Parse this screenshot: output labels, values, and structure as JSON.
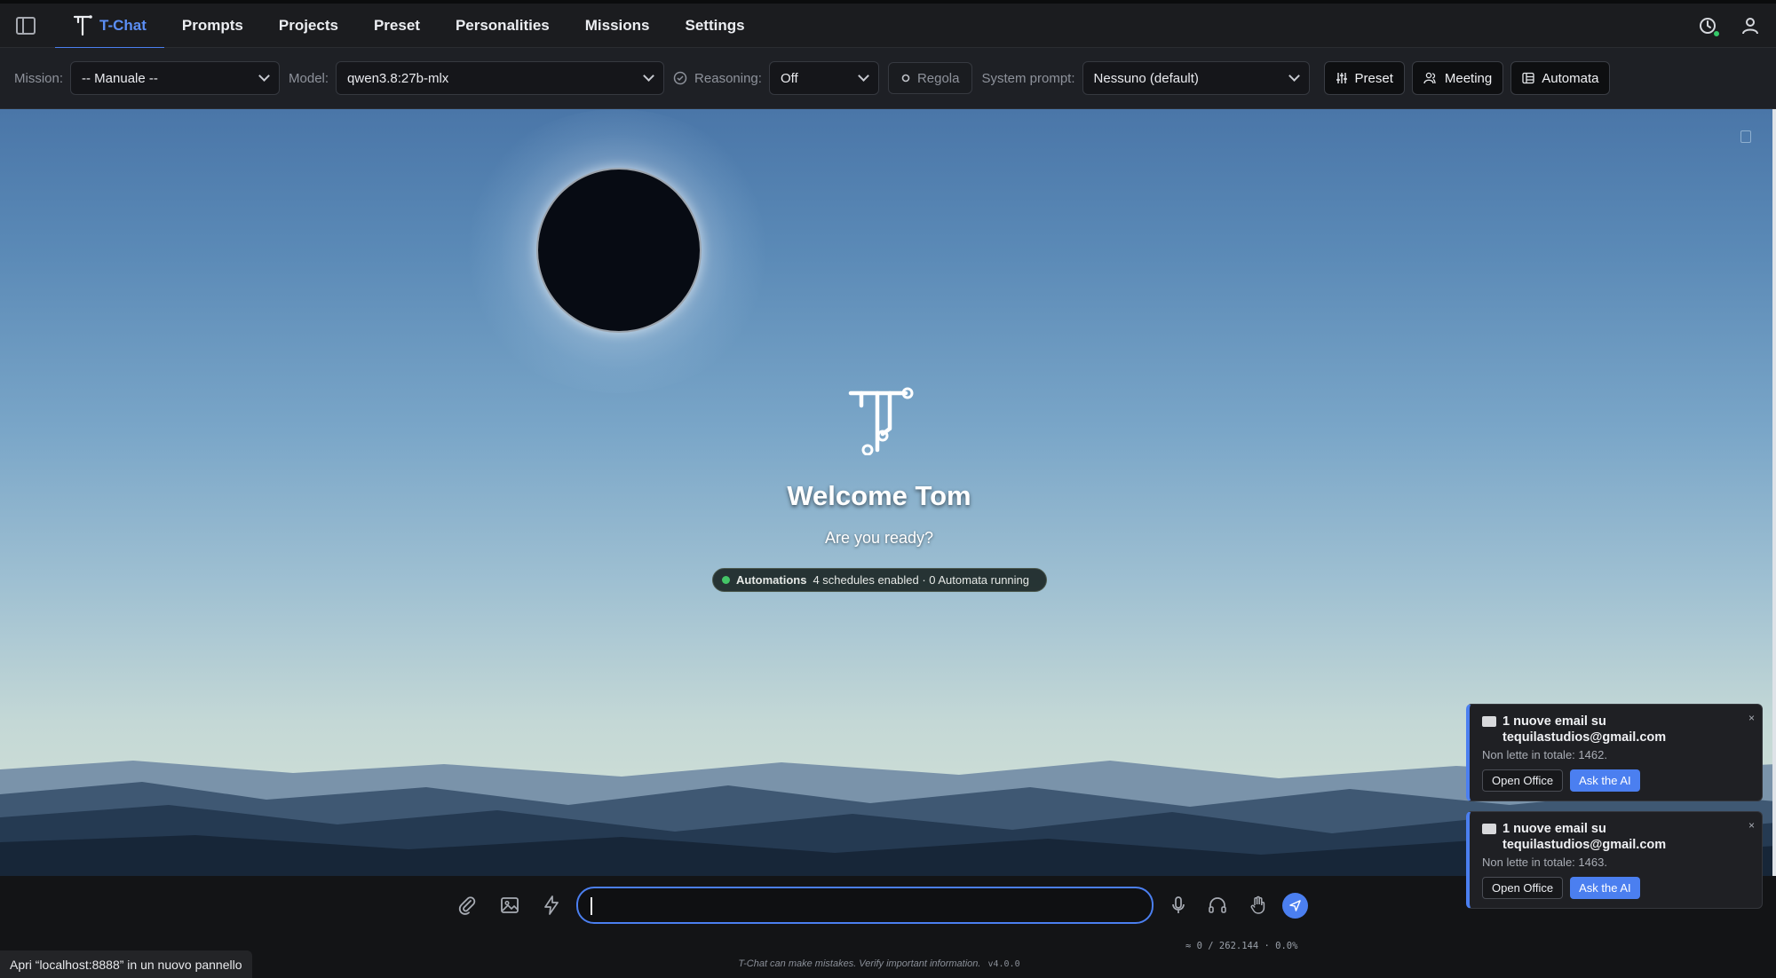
{
  "nav": {
    "items": [
      {
        "label": "T-Chat",
        "active": true
      },
      {
        "label": "Prompts"
      },
      {
        "label": "Projects"
      },
      {
        "label": "Preset"
      },
      {
        "label": "Personalities"
      },
      {
        "label": "Missions"
      },
      {
        "label": "Settings"
      }
    ]
  },
  "toolbar": {
    "mission_label": "Mission:",
    "mission_value": "-- Manuale --",
    "model_label": "Model:",
    "model_value": "qwen3.8:27b-mlx",
    "reasoning_label": "Reasoning:",
    "reasoning_value": "Off",
    "regola_label": "Regola",
    "system_prompt_label": "System prompt:",
    "system_prompt_value": "Nessuno (default)",
    "preset_label": "Preset",
    "meeting_label": "Meeting",
    "automata_label": "Automata"
  },
  "hero": {
    "welcome": "Welcome Tom",
    "subtitle": "Are you ready?",
    "automations_label": "Automations",
    "automations_status": "4 schedules enabled · 0 Automata running"
  },
  "chat": {
    "input_placeholder": "",
    "token_info": "≈ 0 / 262.144 · 0.0%",
    "disclaimer": "T-Chat can make mistakes. Verify important information.",
    "version": "v4.0.0"
  },
  "status_tip": "Apri “localhost:8888” in un nuovo pannello",
  "notifications": [
    {
      "title": "1 nuove email su tequilastudios@gmail.com",
      "subtitle": "Non lette in totale: 1462.",
      "open_label": "Open Office",
      "ask_label": "Ask the AI",
      "close": "×"
    },
    {
      "title": "1 nuove email su tequilastudios@gmail.com",
      "subtitle": "Non lette in totale: 1463.",
      "open_label": "Open Office",
      "ask_label": "Ask the AI",
      "close": "×"
    }
  ],
  "colors": {
    "accent": "#4b7ff0",
    "online": "#35c96a",
    "automation_dot": "#44c567"
  }
}
